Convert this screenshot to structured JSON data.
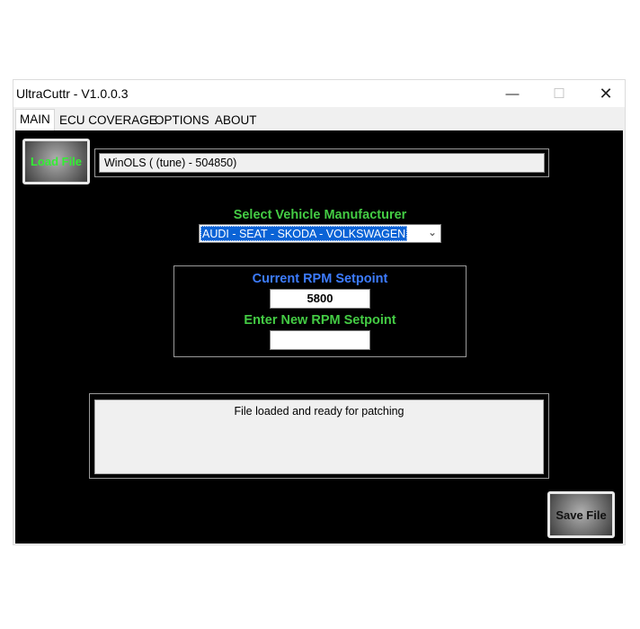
{
  "window": {
    "title": "UltraCuttr - V1.0.0.3",
    "minimize_glyph": "—",
    "maximize_glyph": "☐",
    "close_glyph": "✕"
  },
  "tabs": [
    {
      "label": "MAIN",
      "active": true
    },
    {
      "label": "ECU COVERAGE",
      "active": false
    },
    {
      "label": "OPTIONS",
      "active": false
    },
    {
      "label": "ABOUT",
      "active": false
    }
  ],
  "main": {
    "load_button_label": "Load File",
    "file_field_value": "WinOLS ( (tune) - 504850)",
    "manufacturer_label": "Select Vehicle Manufacturer",
    "manufacturer_selected": "AUDI - SEAT - SKODA - VOLKSWAGEN",
    "current_rpm_label": "Current RPM Setpoint",
    "current_rpm_value": "5800",
    "new_rpm_label": "Enter New RPM Setpoint",
    "new_rpm_value": "",
    "status_message": "File loaded and ready for patching",
    "save_button_label": "Save File"
  },
  "colors": {
    "panel_bg": "#000000",
    "label_green": "#44cc44",
    "label_blue": "#3d7cff",
    "selection_blue": "#0a63d6"
  }
}
